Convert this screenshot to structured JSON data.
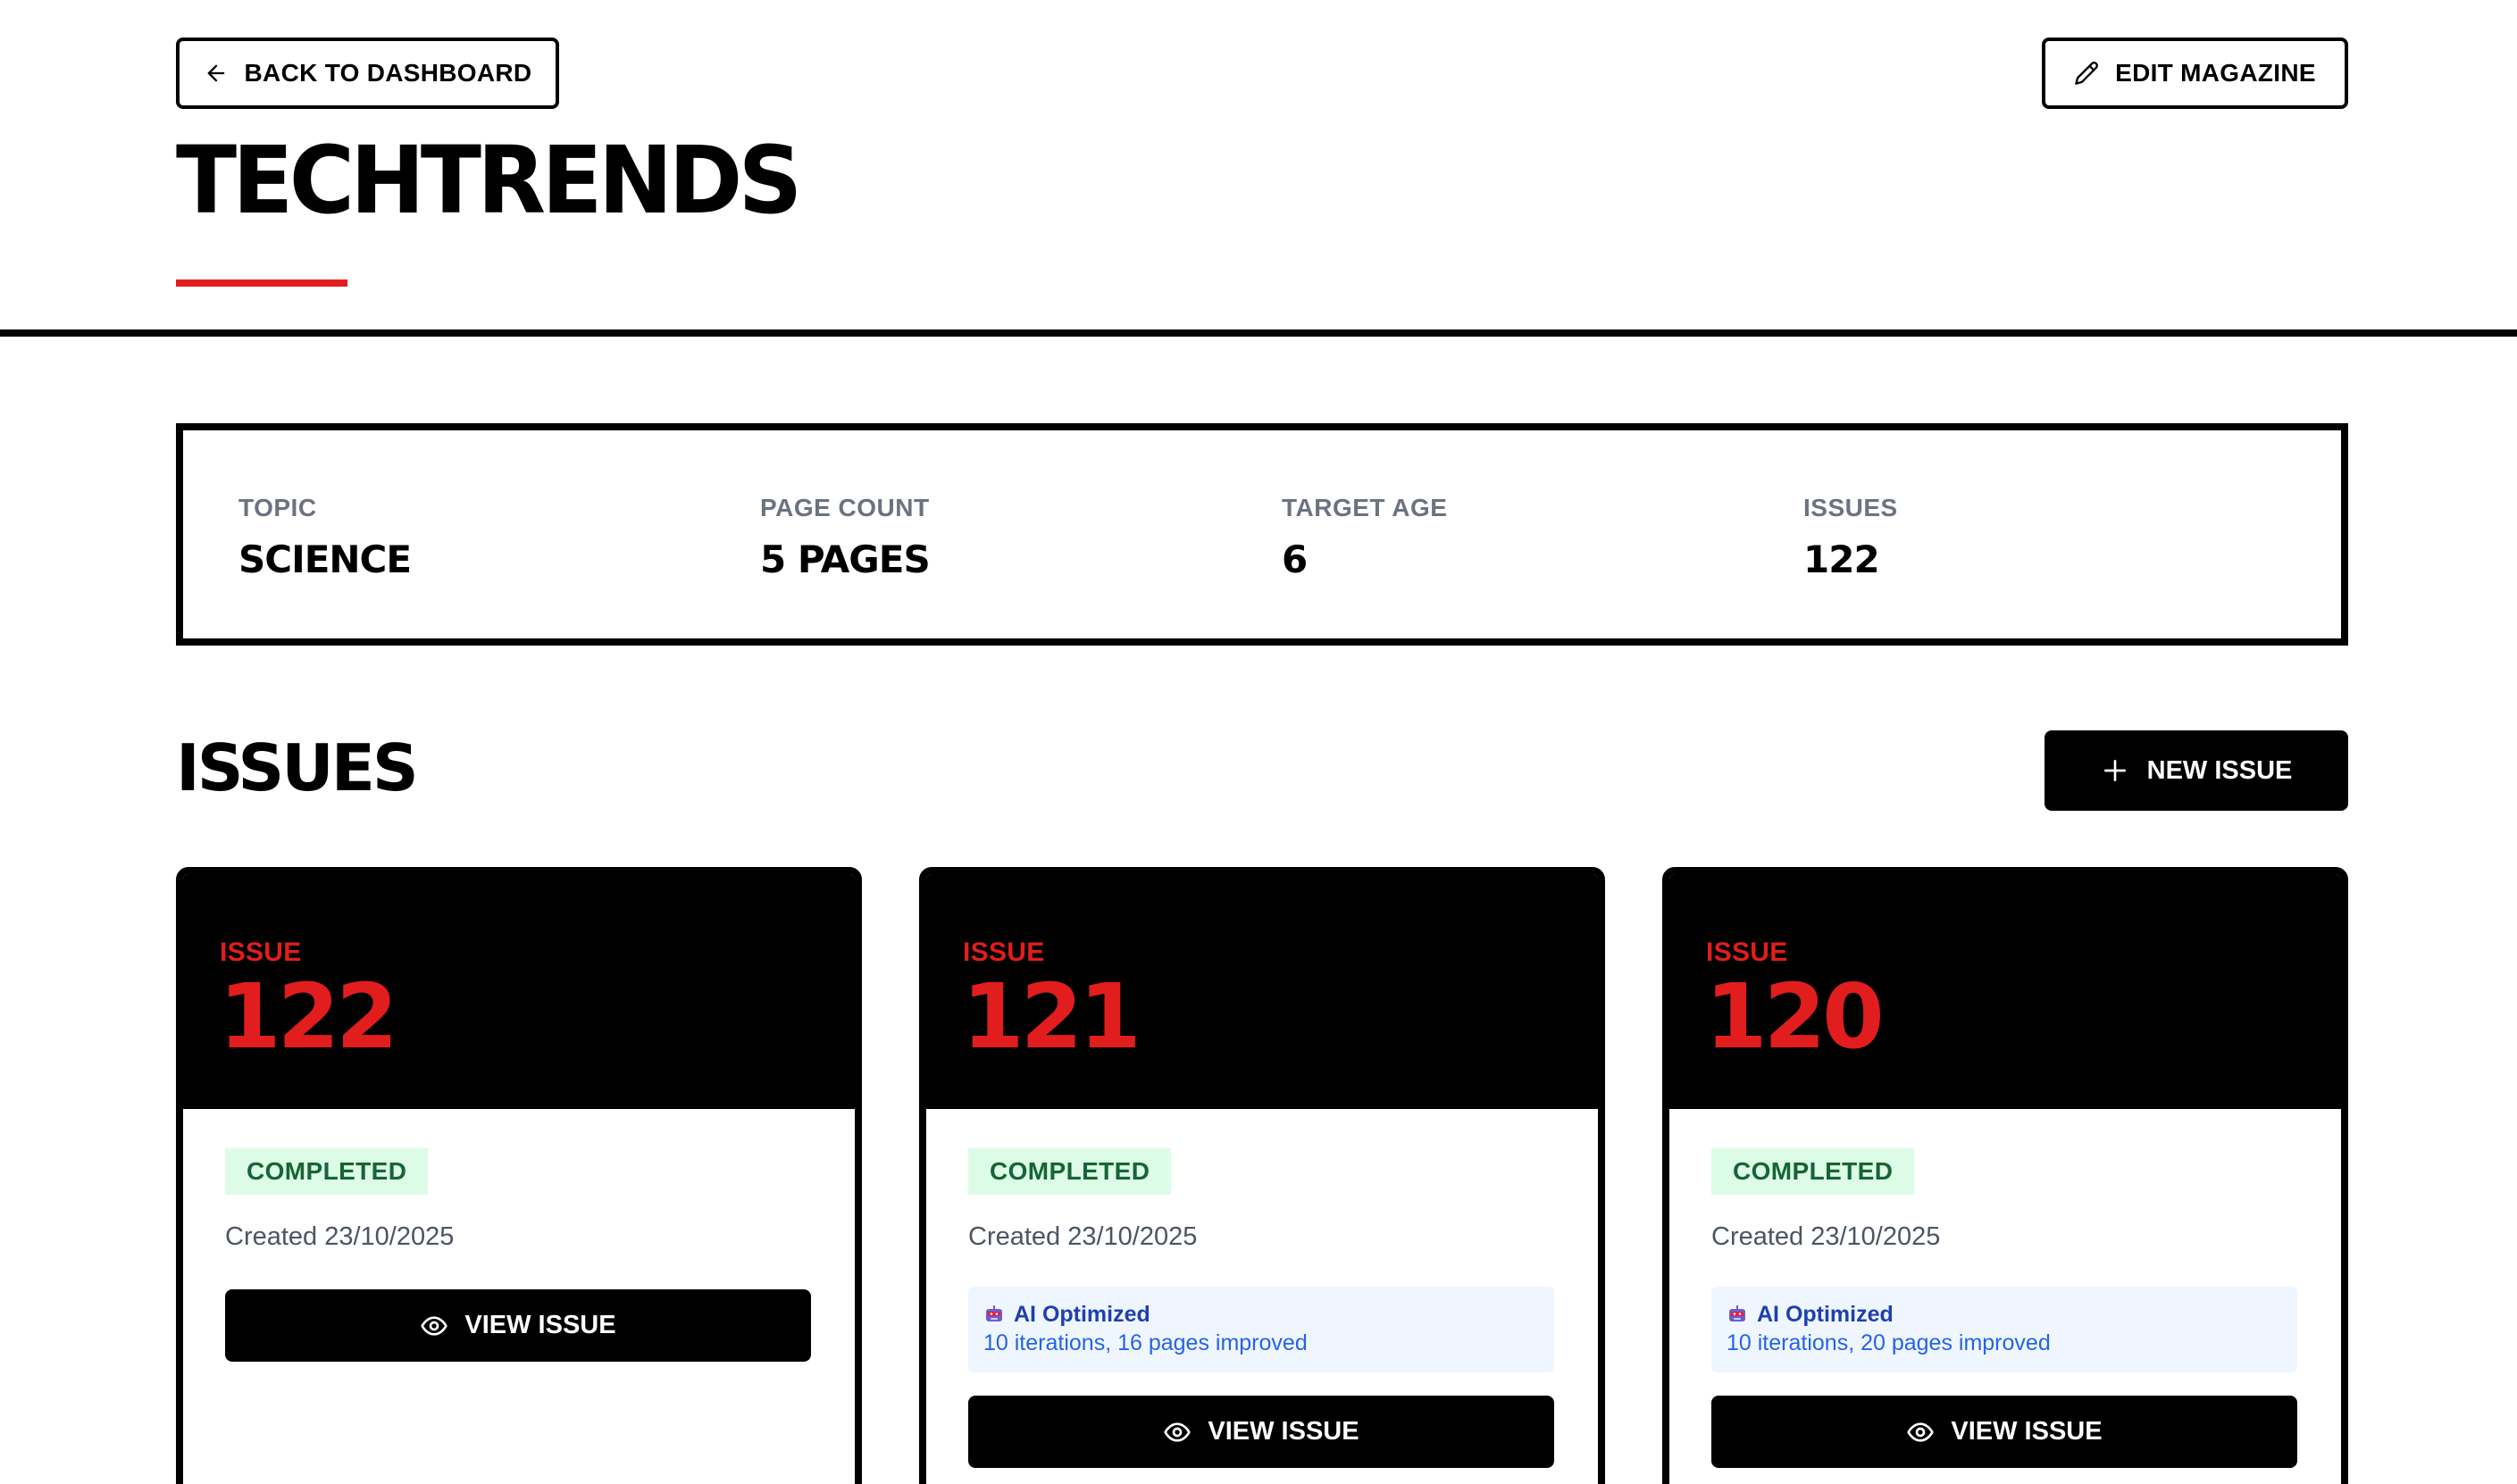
{
  "header": {
    "back_label": "BACK TO DASHBOARD",
    "edit_label": "EDIT MAGAZINE",
    "title": "TECHTRENDS"
  },
  "info": {
    "topic_label": "TOPIC",
    "topic_value": "SCIENCE",
    "page_count_label": "PAGE COUNT",
    "page_count_value": "5 PAGES",
    "target_age_label": "TARGET AGE",
    "target_age_value": "6",
    "issues_label": "ISSUES",
    "issues_value": "122"
  },
  "issues_section": {
    "title": "ISSUES",
    "new_issue_label": "NEW ISSUE"
  },
  "cards": [
    {
      "issue_label": "ISSUE",
      "number": "122",
      "status": "COMPLETED",
      "created": "Created 23/10/2025",
      "view_label": "VIEW ISSUE"
    },
    {
      "issue_label": "ISSUE",
      "number": "121",
      "status": "COMPLETED",
      "created": "Created 23/10/2025",
      "ai_title": "AI Optimized",
      "ai_desc": "10 iterations, 16 pages improved",
      "view_label": "VIEW ISSUE"
    },
    {
      "issue_label": "ISSUE",
      "number": "120",
      "status": "COMPLETED",
      "created": "Created 23/10/2025",
      "ai_title": "AI Optimized",
      "ai_desc": "10 iterations, 20 pages improved",
      "view_label": "VIEW ISSUE"
    }
  ],
  "colors": {
    "accent": "#e11d1d",
    "status_bg": "#dcfce7",
    "status_text": "#166534",
    "ai_bg": "#eff6ff",
    "ai_text": "#1e40af"
  },
  "icons": {
    "back": "arrow-left-icon",
    "edit": "pencil-icon",
    "new": "plus-icon",
    "view": "eye-icon",
    "ai": "robot-icon"
  }
}
